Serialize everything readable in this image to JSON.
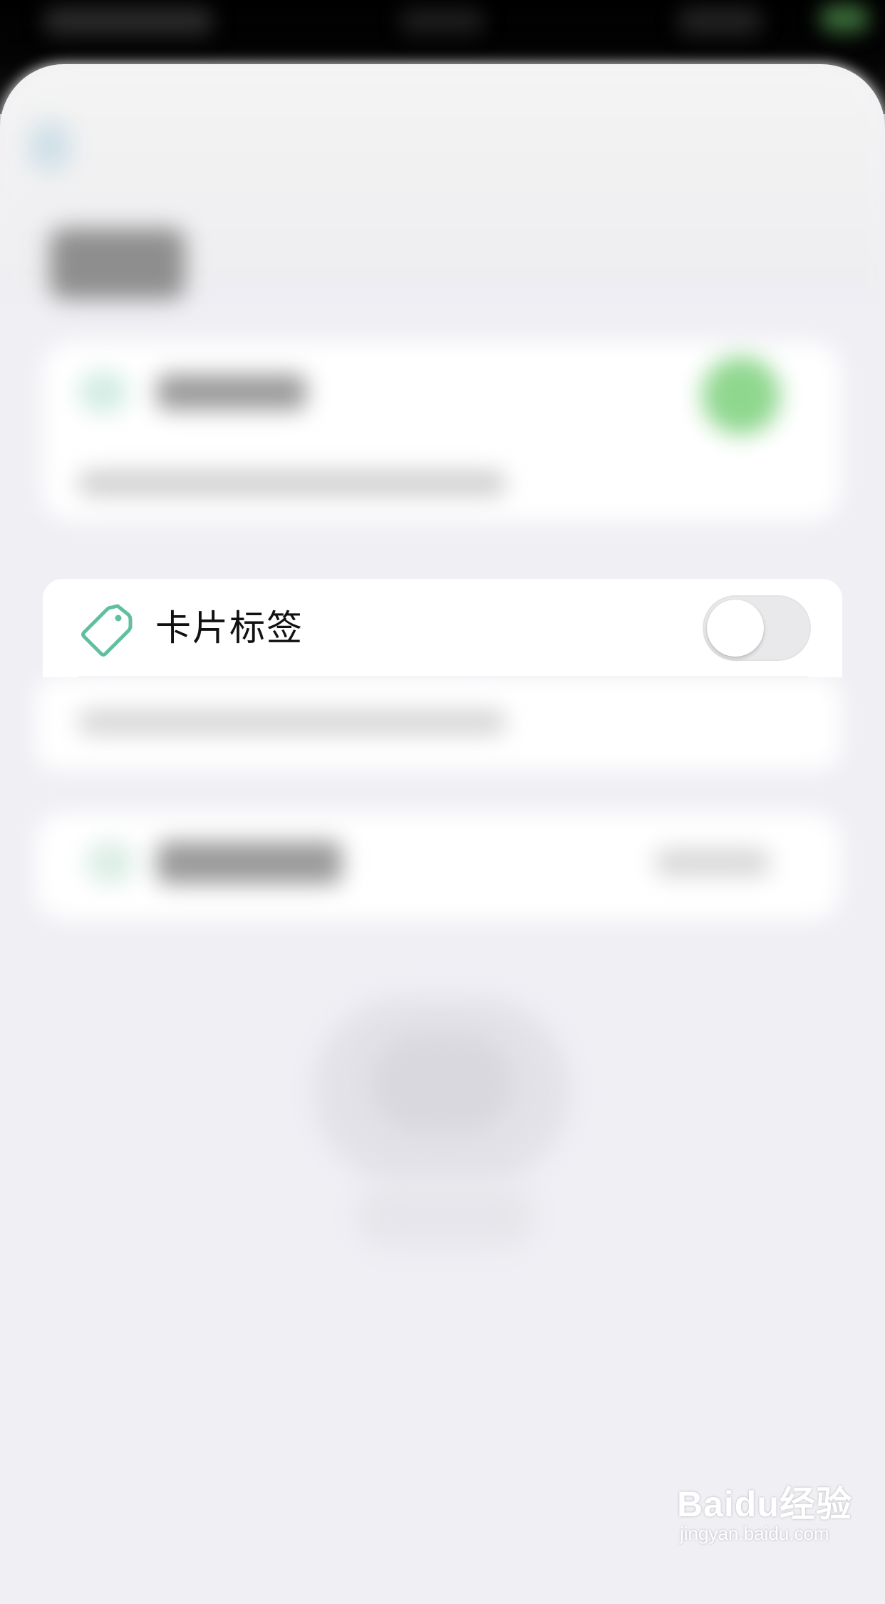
{
  "setting_card": {
    "label": "卡片标签",
    "toggle_on": false,
    "icon": "tag-icon",
    "accent_color": "#5fbf9f"
  },
  "watermark": {
    "logo_text": "Baidu经验",
    "url": "jingyan.baidu.com"
  }
}
